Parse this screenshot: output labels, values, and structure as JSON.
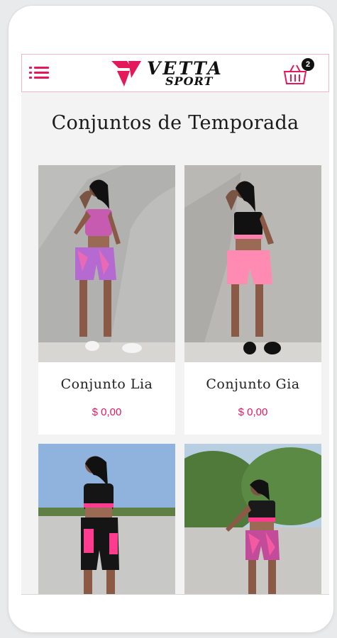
{
  "header": {
    "logo_line1": "VETTA",
    "logo_line2": "SPORT",
    "cart_count": "2"
  },
  "page": {
    "title": "Conjuntos de Temporada"
  },
  "products": [
    {
      "name": "Conjunto Lia",
      "price": "$ 0,00"
    },
    {
      "name": "Conjunto Gia",
      "price": "$ 0,00"
    }
  ],
  "colors": {
    "brand_pink": "#e3195c",
    "text_dark": "#1a1a1a"
  },
  "icons": {
    "menu": "hamburger-menu-icon",
    "cart": "shopping-basket-icon",
    "logo_mark": "vetta-logo-mark"
  }
}
